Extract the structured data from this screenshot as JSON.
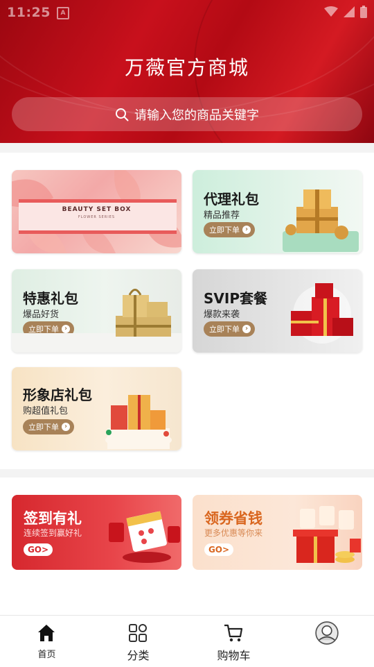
{
  "status_bar": {
    "time": "11:25",
    "sim_icon": "A"
  },
  "header": {
    "title": "万薇官方商城",
    "brand_color": "#c8101c"
  },
  "search": {
    "placeholder": "请输入您的商品关键字"
  },
  "banner": {
    "box_text": "BEAUTY SET BOX",
    "box_subtext": "FLOWER SERIES"
  },
  "cards": [
    {
      "title": "代理礼包",
      "subtitle": "精品推荐",
      "button": "立即下单"
    },
    {
      "title": "特惠礼包",
      "subtitle": "爆品好货",
      "button": "立即下单"
    },
    {
      "title": "SVIP套餐",
      "subtitle": "爆款来袭",
      "button": "立即下单"
    },
    {
      "title": "形象店礼包",
      "subtitle": "购超值礼包",
      "button": "立即下单"
    }
  ],
  "promos": [
    {
      "title": "签到有礼",
      "subtitle": "连续签到赢好礼",
      "button": "GO>"
    },
    {
      "title": "领券省钱",
      "subtitle": "更多优惠等你来",
      "button": "GO>"
    }
  ],
  "tabs": [
    {
      "label": "首页",
      "icon": "home-icon"
    },
    {
      "label": "分类",
      "icon": "category-icon"
    },
    {
      "label": "购物车",
      "icon": "cart-icon"
    },
    {
      "label": "",
      "icon": "avatar-icon"
    }
  ]
}
